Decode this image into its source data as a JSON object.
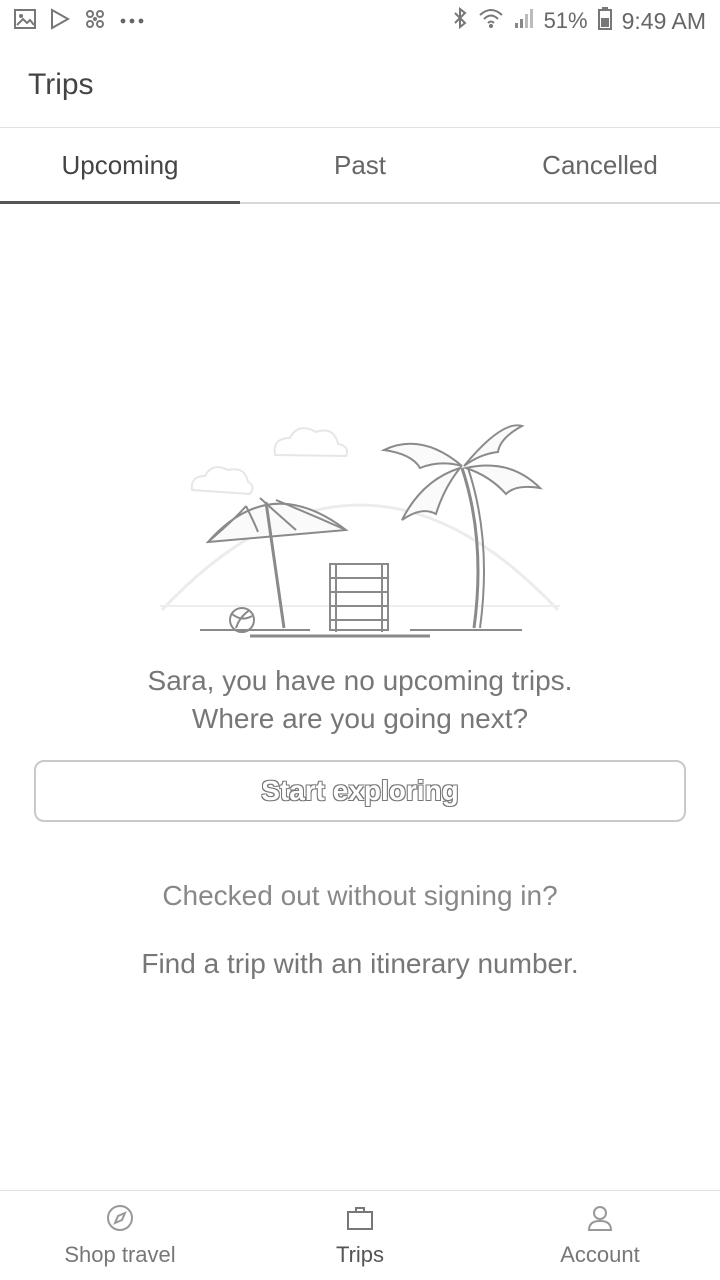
{
  "status_bar": {
    "battery": "51%",
    "time": "9:49 AM",
    "left_icons": [
      "image-icon",
      "play-store-icon",
      "pinwheel-icon",
      "more-dots-icon"
    ],
    "right_icons": [
      "bluetooth-icon",
      "wifi-icon",
      "signal-icon",
      "battery-icon"
    ]
  },
  "header": {
    "title": "Trips"
  },
  "tabs": [
    {
      "label": "Upcoming",
      "active": true
    },
    {
      "label": "Past",
      "active": false
    },
    {
      "label": "Cancelled",
      "active": false
    }
  ],
  "empty_state": {
    "line1": "Sara, you have no upcoming trips.",
    "line2": "Where are you going next?",
    "button_label": "Start exploring",
    "checked_out_text": "Checked out without signing in?",
    "find_trip_link": "Find a trip with an itinerary number."
  },
  "bottom_nav": [
    {
      "label": "Shop travel",
      "icon": "compass-icon",
      "active": false
    },
    {
      "label": "Trips",
      "icon": "suitcase-icon",
      "active": true
    },
    {
      "label": "Account",
      "icon": "person-icon",
      "active": false
    }
  ]
}
